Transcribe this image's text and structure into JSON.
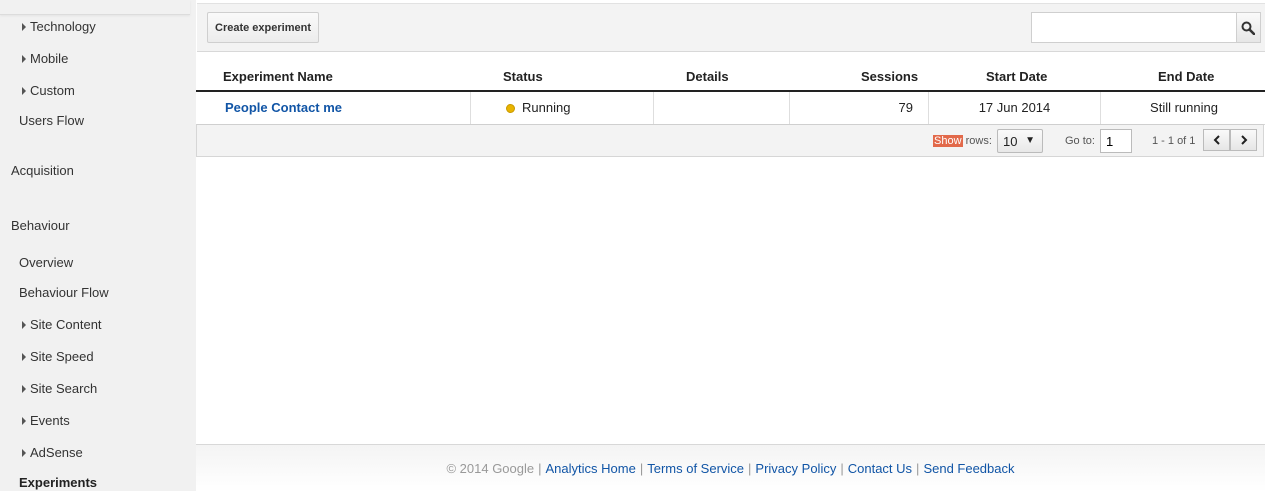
{
  "sidebar": {
    "items": [
      {
        "label": "Technology",
        "expandable": true
      },
      {
        "label": "Mobile",
        "expandable": true
      },
      {
        "label": "Custom",
        "expandable": true
      },
      {
        "label": "Users Flow",
        "expandable": false
      },
      {
        "label": "Acquisition",
        "expandable": false
      },
      {
        "label": "Behaviour",
        "expandable": false
      },
      {
        "label": "Overview",
        "expandable": false
      },
      {
        "label": "Behaviour Flow",
        "expandable": false
      },
      {
        "label": "Site Content",
        "expandable": true
      },
      {
        "label": "Site Speed",
        "expandable": true
      },
      {
        "label": "Site Search",
        "expandable": true
      },
      {
        "label": "Events",
        "expandable": true
      },
      {
        "label": "AdSense",
        "expandable": true
      },
      {
        "label": "Experiments",
        "expandable": false,
        "selected": true
      }
    ]
  },
  "toolbar": {
    "create_label": "Create experiment",
    "search_value": "",
    "search_icon": "magnifier-icon"
  },
  "table": {
    "columns": [
      "Experiment Name",
      "Status",
      "Details",
      "Sessions",
      "Start Date",
      "End Date"
    ],
    "rows": [
      {
        "name": "People Contact me",
        "status": "Running",
        "status_color": "#e9b400",
        "details": "",
        "sessions": "79",
        "start_date": "17 Jun 2014",
        "end_date": "Still running"
      }
    ]
  },
  "pager": {
    "show_label": "Show",
    "rows_label": "rows:",
    "rows_value": "10",
    "goto_label": "Go to:",
    "goto_value": "1",
    "range_text": "1 - 1 of 1",
    "prev_icon": "chevron-left-icon",
    "next_icon": "chevron-right-icon"
  },
  "footer": {
    "copyright": "© 2014 Google",
    "links": [
      "Analytics Home",
      "Terms of Service",
      "Privacy Policy",
      "Contact Us",
      "Send Feedback"
    ]
  },
  "colors": {
    "link": "#1155a6",
    "highlight": "#e2694a",
    "sidebar_bg": "#f1f1f1"
  }
}
